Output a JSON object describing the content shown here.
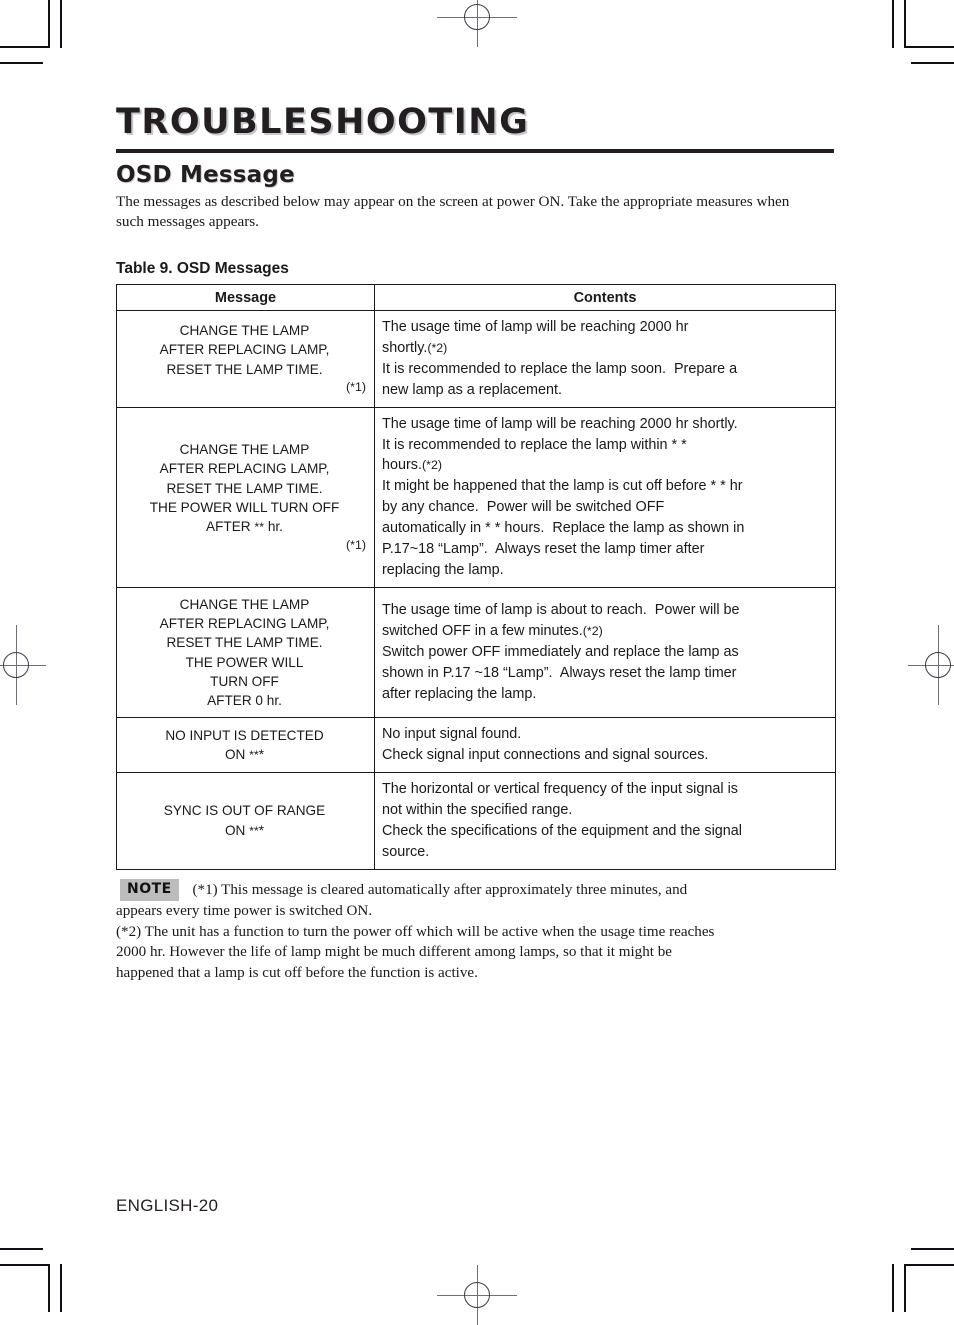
{
  "document": {
    "title": "TROUBLESHOOTING",
    "section_title": "OSD Message",
    "intro": "The messages as described below may appear on the screen at power ON. Take the appropriate measures when such messages appears.",
    "footer": "ENGLISH-20"
  },
  "table": {
    "caption": "Table 9. OSD Messages",
    "headers": {
      "message": "Message",
      "contents": "Contents"
    },
    "rows": [
      {
        "message_lines": [
          "CHANGE THE LAMP",
          "AFTER REPLACING LAMP,",
          "RESET THE LAMP TIME."
        ],
        "message_ref": "(*1)",
        "contents_lines": [
          "The usage time of lamp will be reaching 2000 hr",
          "shortly.(*2)",
          "It is recommended to replace the lamp soon.  Prepare a",
          "new lamp as a replacement."
        ]
      },
      {
        "message_lines": [
          "CHANGE THE LAMP",
          "AFTER REPLACING LAMP,",
          "RESET THE LAMP TIME.",
          "THE POWER WILL TURN OFF",
          "AFTER ** hr."
        ],
        "message_ref": "(*1)",
        "contents_lines": [
          "The usage time of lamp will be reaching 2000 hr shortly.",
          "It is recommended to replace the lamp within * *",
          "hours.(*2)",
          "It might be happened that the lamp is cut off before * * hr",
          "by any chance.  Power will be switched OFF",
          "automatically in * * hours.  Replace the lamp as shown in",
          "P.17~18 “Lamp”.  Always reset the lamp timer after",
          "replacing the lamp."
        ]
      },
      {
        "message_lines": [
          "CHANGE THE LAMP",
          "AFTER REPLACING LAMP,",
          "RESET THE LAMP TIME.",
          "THE POWER WILL",
          "TURN OFF",
          "AFTER 0 hr."
        ],
        "message_ref": "",
        "contents_lines": [
          "The usage time of lamp is about to reach.  Power will be",
          "switched OFF in a few minutes.(*2)",
          "Switch power OFF immediately and replace the lamp as",
          "shown in P.17 ~18 “Lamp”.  Always reset the lamp timer",
          "after replacing the lamp."
        ]
      },
      {
        "message_lines": [
          "NO INPUT IS DETECTED",
          "ON ***"
        ],
        "message_ref": "",
        "contents_lines": [
          "No input signal found.",
          "Check signal input connections and signal sources."
        ]
      },
      {
        "message_lines": [
          "SYNC IS OUT OF RANGE",
          "ON ***"
        ],
        "message_ref": "",
        "contents_lines": [
          "The horizontal or vertical frequency of the input signal is",
          "not within the specified range.",
          "Check the specifications of the equipment and the signal",
          "source."
        ]
      }
    ]
  },
  "note": {
    "badge": "NOTE",
    "lines": [
      "(*1) This message is cleared automatically after approximately three minutes, and",
      "appears every time power is switched ON.",
      "(*2) The unit has a function to turn the power off which will be active when the usage time reaches",
      "2000 hr.  However the life of lamp might be much different among lamps, so that it might be",
      "happened that a lamp is cut off before the function is active."
    ]
  },
  "colors": {
    "ink": "#231f20",
    "note_badge_bg": "#bcbcbc",
    "registration_mark": "#6f6f78"
  }
}
